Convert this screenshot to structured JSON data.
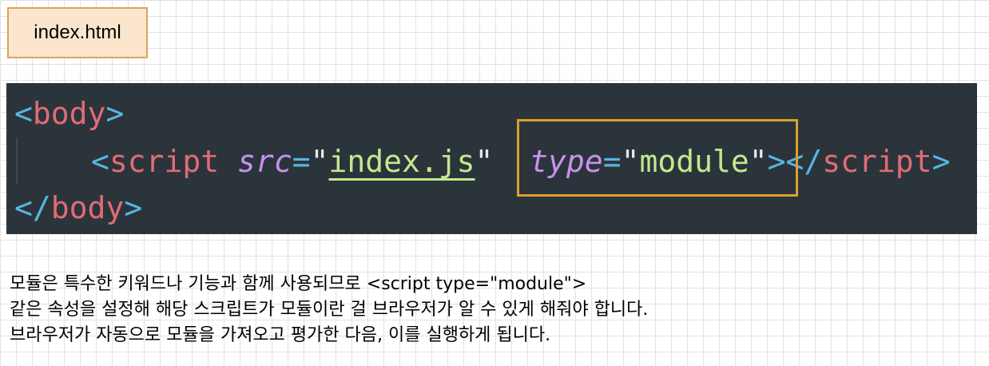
{
  "file_label": "index.html",
  "code": {
    "line1": {
      "open": "<",
      "tag": "body",
      "close": ">"
    },
    "line2": {
      "open": "<",
      "tag": "script",
      "attr1_name": "src",
      "eq1": "=",
      "q1a": "\"",
      "attr1_value": "index.js",
      "q1b": "\"",
      "attr2_name": "type",
      "eq2": "=",
      "q2a": "\"",
      "attr2_value": "module",
      "q2b": "\"",
      "gt": ">",
      "close_open": "</",
      "close_tag": "script",
      "close_gt": ">"
    },
    "line3": {
      "open": "</",
      "tag": "body",
      "close": ">"
    }
  },
  "colors": {
    "code_background": "#2b343b",
    "highlight_border": "#daa12d",
    "label_background": "#fce5cd",
    "label_border": "#d9a55b"
  },
  "caption": {
    "line1": "모듈은 특수한 키워드나 기능과 함께 사용되므로 <script type=\"module\">",
    "line2": "같은 속성을 설정해 해당 스크립트가 모듈이란 걸 브라우저가 알 수 있게 해줘야 합니다.",
    "line3": "브라우저가 자동으로 모듈을 가져오고 평가한 다음, 이를 실행하게 됩니다."
  }
}
